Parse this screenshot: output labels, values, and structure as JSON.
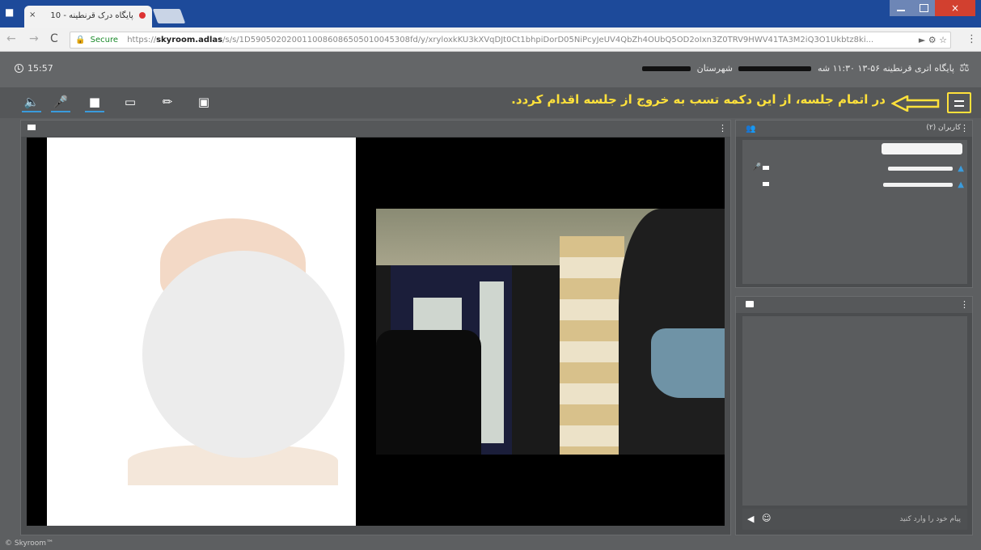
{
  "browser": {
    "tab_title": "پایگاه درک قرنطینه - 10",
    "tab_close": "×",
    "window_close": "×",
    "secure_label": "Secure",
    "url_scheme": "https://",
    "url_host": "skyroom.adlas",
    "url_rest": "/s/s/1D5905020200110086086505010045308fd/y/xryloxkKU3kXVqDJt0Ct1bhpiDorD05NiPcyJeUV4QbZh4OUbQ5OD2oIxn3Z0TRV9HWV41TA3M2iQ3O1Ukbtz8ki...",
    "reload_glyph": "C",
    "back_glyph": "←",
    "forward_glyph": "→",
    "menu_glyph": "⋮"
  },
  "header": {
    "clock": "15:57",
    "title_start": "پایگاه اتری قرنطینه  ۵۶-۱۳  ۱۱:۳۰  شه",
    "title_mid": "شهرستان",
    "title_end": ""
  },
  "toolbar": {
    "annotation": "در اتمام جلسه، از این دکمه تسب به خروج از جلسه اقدام کردد."
  },
  "users_panel": {
    "title": "کاربران (۲)"
  },
  "chat_panel": {
    "placeholder": "پیام خود را وارد کنید"
  },
  "footer": {
    "brand": "© Skyroom™"
  },
  "colors": {
    "annotation": "#ffe13b",
    "accent_blue": "#3a9bdc",
    "tab_bar": "#1d4a9a"
  },
  "icons": [
    "profile-icon",
    "lock-icon",
    "reload-icon",
    "clock-icon",
    "speaker-icon",
    "mic-icon",
    "camera-icon",
    "screen-share-icon",
    "pen-icon",
    "record-icon",
    "arrow-left-icon",
    "hamburger-menu-icon",
    "users-icon",
    "user-icon",
    "chat-icon",
    "send-icon",
    "emoji-icon",
    "kebab-icon"
  ]
}
